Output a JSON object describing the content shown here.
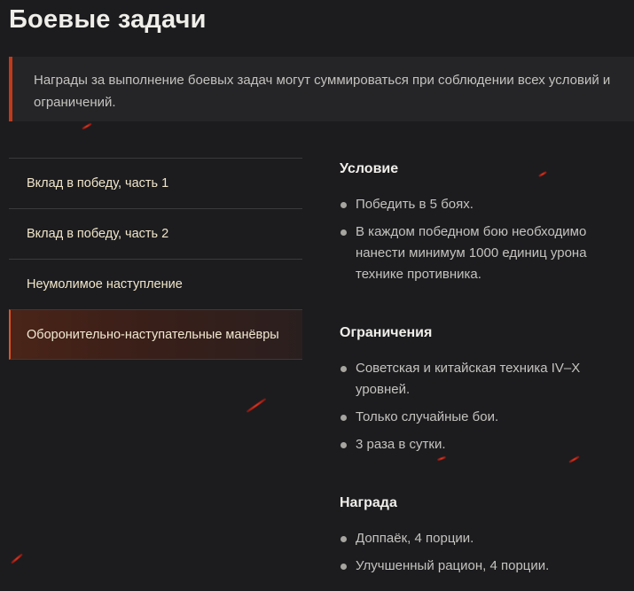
{
  "header": {
    "title": "Боевые задачи"
  },
  "notice": {
    "text": "Награды за выполнение боевых задач могут суммироваться при соблюдении всех условий и ограничений."
  },
  "tabs": [
    {
      "label": "Вклад в победу, часть 1",
      "active": false
    },
    {
      "label": "Вклад в победу, часть 2",
      "active": false
    },
    {
      "label": "Неумолимое наступление",
      "active": false
    },
    {
      "label": "Оборонительно-наступательные манёвры",
      "active": true
    }
  ],
  "details": {
    "condition": {
      "heading": "Условие",
      "items": [
        "Победить в 5 боях.",
        "В каждом победном бою необходимо нанести минимум 1000 единиц урона технике противника."
      ]
    },
    "restrictions": {
      "heading": "Ограничения",
      "items": [
        "Советская и китайская техника IV–X уровней.",
        "Только случайные бои.",
        "3 раза в сутки."
      ]
    },
    "reward": {
      "heading": "Награда",
      "items": [
        "Доппаёк, 4 порции.",
        "Улучшенный рацион, 4 порции."
      ]
    }
  },
  "colors": {
    "background": "#1c1c1f",
    "accent": "#c23a1a",
    "tab_text": "#f1e6cb"
  }
}
